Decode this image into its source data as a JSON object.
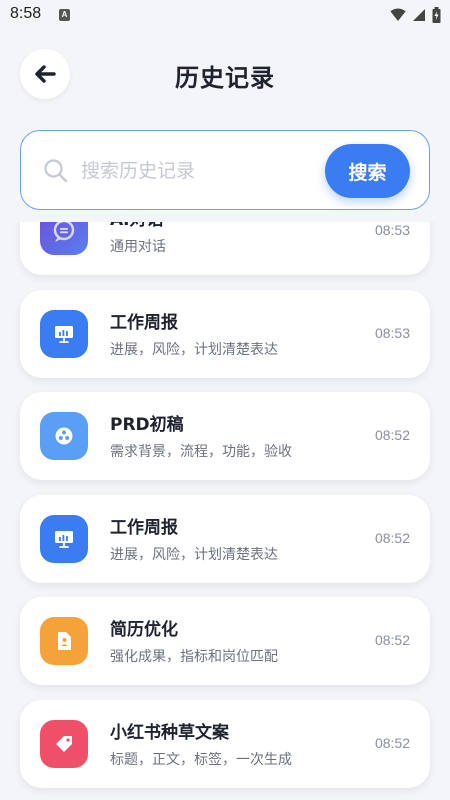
{
  "status_bar": {
    "time": "8:58",
    "a_badge": "A"
  },
  "header": {
    "title": "历史记录",
    "back_icon": "arrow-left-icon"
  },
  "search": {
    "placeholder": "搜索历史记录",
    "value": "",
    "button_label": "搜索"
  },
  "history": [
    {
      "title": "AI对话",
      "subtitle": "通用对话",
      "time": "08:53",
      "icon": "chat-bubble-icon",
      "color": "#6c4fd6",
      "color2": "#5a7ef0"
    },
    {
      "title": "工作周报",
      "subtitle": "进展，风险，计划清楚表达",
      "time": "08:53",
      "icon": "presentation-icon",
      "color": "#3a7cf2",
      "color2": "#3a7cf2"
    },
    {
      "title": "PRD初稿",
      "subtitle": "需求背景，流程，功能，验收",
      "time": "08:52",
      "icon": "cluster-icon",
      "color": "#5a9ef6",
      "color2": "#5a9ef6"
    },
    {
      "title": "工作周报",
      "subtitle": "进展，风险，计划清楚表达",
      "time": "08:52",
      "icon": "presentation-icon",
      "color": "#3a7cf2",
      "color2": "#3a7cf2"
    },
    {
      "title": "简历优化",
      "subtitle": "强化成果，指标和岗位匹配",
      "time": "08:52",
      "icon": "document-icon",
      "color": "#f6a23a",
      "color2": "#f6a23a"
    },
    {
      "title": "小红书种草文案",
      "subtitle": "标题，正文，标签，一次生成",
      "time": "08:52",
      "icon": "tag-icon",
      "color": "#f04f6a",
      "color2": "#f04f6a"
    }
  ]
}
